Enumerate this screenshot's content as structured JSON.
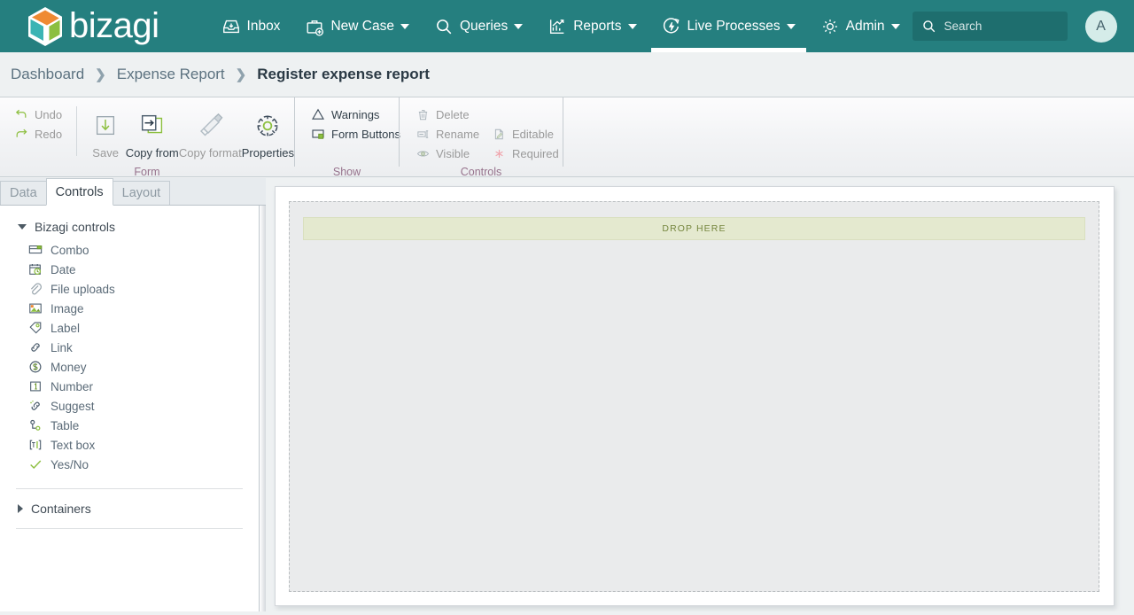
{
  "brand": {
    "name": "bizagi",
    "logo_icon": "bizagi-cube-logo",
    "teal": "#257f7f",
    "logo_orange": "#ef8a33",
    "logo_green": "#8cbf3f",
    "logo_cyan": "#3cb4b4"
  },
  "topnav": {
    "items": [
      {
        "label": "Inbox",
        "icon": "inbox-tray-icon",
        "has_caret": false,
        "active": false
      },
      {
        "label": "New Case",
        "icon": "briefcase-plus-icon",
        "has_caret": true,
        "active": false
      },
      {
        "label": "Queries",
        "icon": "search-icon",
        "has_caret": true,
        "active": false
      },
      {
        "label": "Reports",
        "icon": "bar-chart-arrow-icon",
        "has_caret": true,
        "active": false
      },
      {
        "label": "Live Processes",
        "icon": "live-process-bolt-icon",
        "has_caret": true,
        "active": true
      },
      {
        "label": "Admin",
        "icon": "gear-icon",
        "has_caret": true,
        "active": false
      }
    ],
    "search": {
      "placeholder": "Search",
      "value": "",
      "icon": "search-icon"
    },
    "avatar": {
      "initial": "A",
      "bg": "#d5ece9"
    }
  },
  "breadcrumb": {
    "items": [
      "Dashboard",
      "Expense Report"
    ],
    "separator": "›",
    "current": "Register expense report"
  },
  "ribbon": {
    "groups": [
      {
        "label": "Form",
        "small_buttons": [
          {
            "label": "Undo",
            "icon": "undo-arrow-icon",
            "enabled": false
          },
          {
            "label": "Redo",
            "icon": "redo-arrow-icon",
            "enabled": false
          }
        ],
        "large_buttons": [
          {
            "label": "Save",
            "icon": "save-download-icon",
            "enabled": false
          },
          {
            "label": "Copy from",
            "icon": "copy-from-icon",
            "enabled": true
          },
          {
            "label": "Copy format",
            "icon": "copy-format-brush-icon",
            "enabled": false
          },
          {
            "label": "Properties",
            "icon": "properties-gear-icon",
            "enabled": true
          }
        ]
      },
      {
        "label": "Show",
        "small_buttons": [
          {
            "label": "Warnings",
            "icon": "warning-triangle-icon",
            "enabled": true
          },
          {
            "label": "Form Buttons",
            "icon": "form-buttons-icon",
            "enabled": true
          }
        ],
        "large_buttons": []
      },
      {
        "label": "Controls",
        "columns": [
          [
            {
              "label": "Delete",
              "icon": "trash-icon",
              "enabled": false
            },
            {
              "label": "Rename",
              "icon": "rename-icon",
              "enabled": false
            },
            {
              "label": "Visible",
              "icon": "eye-icon",
              "enabled": false
            }
          ],
          [
            {
              "label": "Editable",
              "icon": "editable-pencil-icon",
              "enabled": false
            },
            {
              "label": "Required",
              "icon": "required-asterisk-icon",
              "enabled": false
            }
          ]
        ]
      }
    ],
    "group_label_color": "#96728c"
  },
  "left_panel": {
    "tabs": [
      {
        "label": "Data",
        "active": false
      },
      {
        "label": "Controls",
        "active": true
      },
      {
        "label": "Layout",
        "active": false
      }
    ],
    "sections": [
      {
        "title": "Bizagi controls",
        "expanded": true,
        "items": [
          {
            "label": "Combo",
            "icon": "combo-box-icon"
          },
          {
            "label": "Date",
            "icon": "calendar-clock-icon"
          },
          {
            "label": "File uploads",
            "icon": "paperclip-icon"
          },
          {
            "label": "Image",
            "icon": "image-picture-icon"
          },
          {
            "label": "Label",
            "icon": "tag-label-icon"
          },
          {
            "label": "Link",
            "icon": "chain-link-icon"
          },
          {
            "label": "Money",
            "icon": "money-dollar-icon"
          },
          {
            "label": "Number",
            "icon": "number-one-box-icon"
          },
          {
            "label": "Suggest",
            "icon": "suggest-link-icon"
          },
          {
            "label": "Table",
            "icon": "table-nodes-icon"
          },
          {
            "label": "Text box",
            "icon": "text-box-icon"
          },
          {
            "label": "Yes/No",
            "icon": "checkmark-icon"
          }
        ]
      },
      {
        "title": "Containers",
        "expanded": false,
        "items": []
      }
    ]
  },
  "canvas": {
    "drop_zone_label": "DROP HERE",
    "drop_zone_bg": "#e4e9cf",
    "drop_zone_text_color": "#76873f",
    "surface_bg": "#eaebec"
  }
}
